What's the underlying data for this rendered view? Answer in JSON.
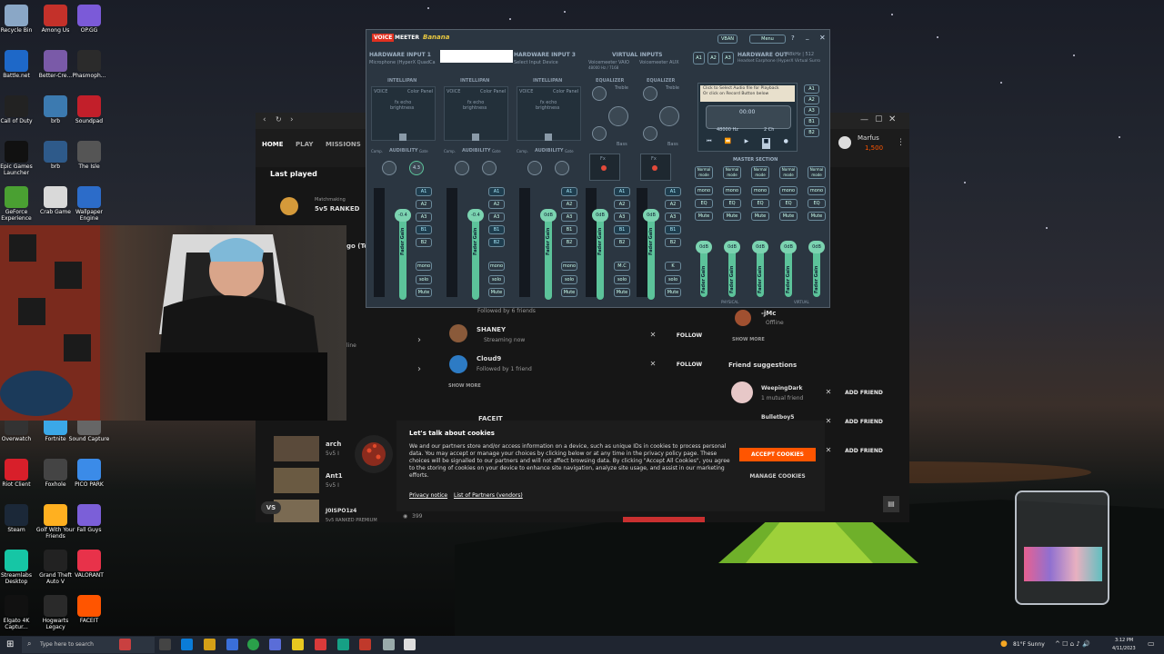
{
  "desktop_icons": [
    {
      "label": "Recycle Bin"
    },
    {
      "label": "Among Us"
    },
    {
      "label": "OP.GG"
    },
    {
      "label": "Battle.net"
    },
    {
      "label": "Better-Cre..."
    },
    {
      "label": "Phasmoph..."
    },
    {
      "label": "Call of Duty"
    },
    {
      "label": "brb"
    },
    {
      "label": "Soundpad"
    },
    {
      "label": "Epic Games Launcher"
    },
    {
      "label": "brb"
    },
    {
      "label": "The Isle"
    },
    {
      "label": "GeForce Experience"
    },
    {
      "label": "Crab Game"
    },
    {
      "label": "Wallpaper Engine"
    },
    {
      "label": "Overwatch"
    },
    {
      "label": "Fortnite"
    },
    {
      "label": "Sound Capture"
    },
    {
      "label": "Riot Client"
    },
    {
      "label": "Foxhole"
    },
    {
      "label": "PICO PARK"
    },
    {
      "label": "Steam"
    },
    {
      "label": "Golf With Your Friends"
    },
    {
      "label": "Fall Guys"
    },
    {
      "label": "Streamlabs Desktop"
    },
    {
      "label": "Grand Theft Auto V"
    },
    {
      "label": "VALORANT"
    },
    {
      "label": "Elgato 4K Captur..."
    },
    {
      "label": "Hogwarts Legacy"
    },
    {
      "label": "FACEIT"
    }
  ],
  "faceit": {
    "nav": [
      "HOME",
      "PLAY",
      "MISSIONS"
    ],
    "last_played": "Last played",
    "match_mode": "Matchmaking",
    "match_title": "5v5 RANKED",
    "match_cut": "go (Te",
    "side_cut": "line",
    "friends_followed_prefix": "Followed by 6 friends",
    "follow_list": [
      {
        "name": "SHANEY",
        "status": "Streaming now",
        "button": "FOLLOW"
      },
      {
        "name": "Cloud9",
        "status": "Followed by 1 friend",
        "button": "FOLLOW"
      }
    ],
    "show_more": "SHOW MORE",
    "faceit_label": "FACEIT",
    "profile_name": "Marfus",
    "profile_points": "1,500",
    "friend_jmc": "-jMc",
    "friend_jmc_status": "Offline",
    "show_more_right": "SHOW MORE",
    "friend_suggestions_title": "Friend suggestions",
    "suggestions": [
      {
        "name": "WeepingDark",
        "sub": "1 mutual friend",
        "button": "ADD FRIEND"
      },
      {
        "name": "Bulletboy5",
        "sub": "",
        "button": "ADD FRIEND"
      },
      {
        "name": "",
        "sub": "",
        "button": "ADD FRIEND"
      }
    ],
    "matches": [
      {
        "name": "arch",
        "mode": "5v5 I"
      },
      {
        "name": "Ant1",
        "mode": "5v5 I"
      },
      {
        "name": "J0ISPO1z4",
        "mode": "5v5 RANKED PREMIUM",
        "views": "399"
      }
    ],
    "vs": "VS"
  },
  "cookie": {
    "title": "Let's talk about cookies",
    "body": "We and our partners store and/or access information on a device, such as unique IDs in cookies to process personal data. You may accept or manage your choices by clicking below or at any time in the privacy policy page. These choices will be signalled to our partners and will not affect browsing data. By clicking \"Accept All Cookies\", you agree to the storing of cookies on your device to enhance site navigation, analyze site usage, and assist in our marketing efforts.",
    "link1": "Privacy notice",
    "link2": "List of Partners (vendors)",
    "accept": "ACCEPT COOKIES",
    "manage": "MANAGE COOKIES"
  },
  "voicemeeter": {
    "brand_voice": "VOICE",
    "brand_meeter": "MEETER",
    "brand_banana": "Banana",
    "vban": "VBAN",
    "menu": "Menu",
    "hw1": "HARDWARE INPUT 1",
    "hw1_dev": "Microphone (HyperX QuadCa",
    "hw3": "HARDWARE INPUT 3",
    "hw3_dev": "Select Input Device",
    "virtual": "VIRTUAL INPUTS",
    "virt1": "Voicemeeter VAIO",
    "virt2": "Voicemeeter AUX",
    "virt_rate": "48000 Hz / 7168",
    "hwout": "HARDWARE OUT",
    "hwout_rate": "48kHz | 512",
    "hwout_dev": "Headset Earphone (HyperX Virtual Surro",
    "intellipan": "INTELLIPAN",
    "voice": "VOICE",
    "color_panel": "Color Panel",
    "fx_echo": "fx echo",
    "brightness": "brightness",
    "equalizer": "EQUALIZER",
    "treble": "Treble",
    "bass": "Bass",
    "audibility": "AUDIBILITY",
    "comp": "Comp.",
    "gate": "Gate",
    "fader_gain": "Fader Gain",
    "knob_value": "4.3",
    "strips": [
      {
        "db": "-0.4",
        "buses": [
          "A1",
          "A2",
          "A3",
          "B1",
          "B2"
        ]
      },
      {
        "db": "-0.4",
        "buses": [
          "A1",
          "A2",
          "A3",
          "B1",
          "B2"
        ]
      },
      {
        "db": "0dB",
        "buses": [
          "A1",
          "A2",
          "A3",
          "B1",
          "B2"
        ]
      },
      {
        "db": "0dB",
        "buses": [
          "A1",
          "A2",
          "A3",
          "B1",
          "B2"
        ]
      },
      {
        "db": "0dB",
        "buses": [
          "A1",
          "A2",
          "A3",
          "B1",
          "B2"
        ]
      }
    ],
    "mono": "mono",
    "solo": "solo",
    "mute": "Mute",
    "mc": "M.C",
    "k": "K",
    "fx_label": "Fx",
    "player_hint1": "Click to Select Audio file for Playback",
    "player_hint2": "Or click on Record Button below",
    "time": "00:00",
    "rate": "48000 Hz",
    "ch": "2 Ch",
    "master_section": "MASTER SECTION",
    "normal_mode": "Normal mode",
    "bus_labels": [
      "A1",
      "A2",
      "A3",
      "B1",
      "B2"
    ],
    "master_db": "0dB",
    "eq_btn": "EQ",
    "physical": "PHYSICAL",
    "virtual_lbl": "VIRTUAL"
  },
  "taskbar": {
    "search": "Type here to search",
    "weather": "81°F  Sunny",
    "time": "3:12 PM",
    "date": "4/11/2023"
  }
}
